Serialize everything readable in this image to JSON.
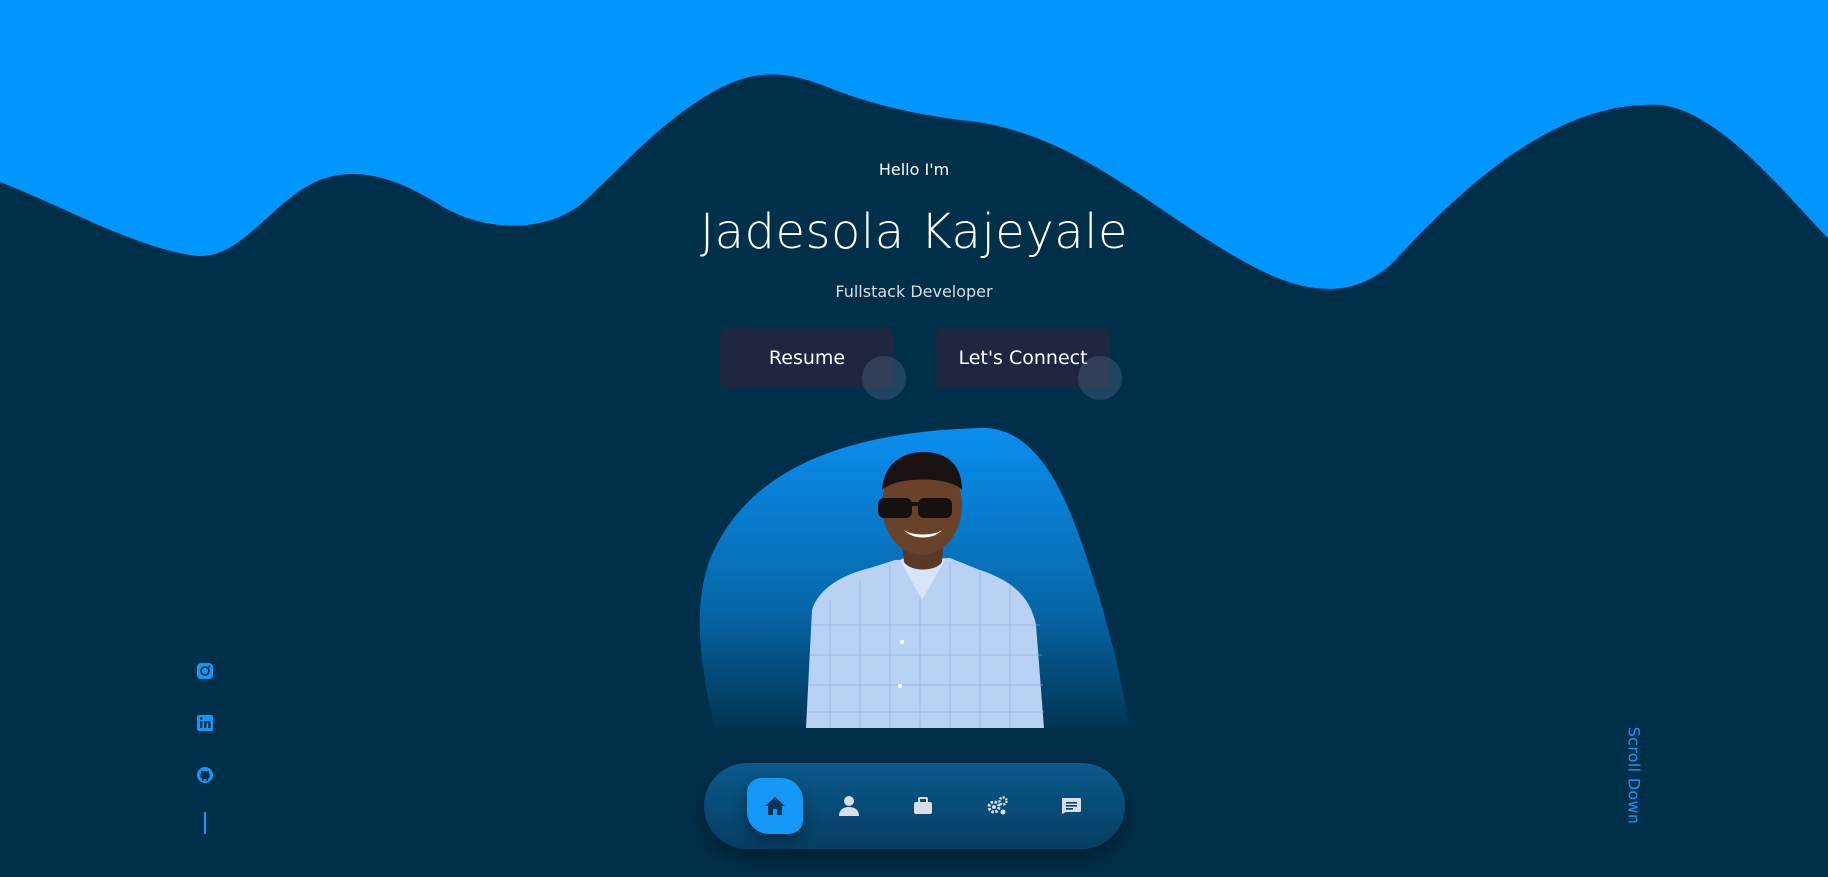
{
  "hero": {
    "greeting": "Hello I'm",
    "name": "Jadesola Kajeyale",
    "role": "Fullstack Developer"
  },
  "buttons": {
    "resume_label": "Resume",
    "connect_label": "Let's Connect"
  },
  "nav": {
    "items": [
      {
        "icon": "home-icon",
        "active": true
      },
      {
        "icon": "user-icon",
        "active": false
      },
      {
        "icon": "briefcase-icon",
        "active": false
      },
      {
        "icon": "gears-icon",
        "active": false
      },
      {
        "icon": "message-icon",
        "active": false
      }
    ]
  },
  "socials": {
    "items": [
      "instagram-icon",
      "linkedin-icon",
      "github-icon"
    ]
  },
  "scroll": {
    "label": "Scroll Down"
  },
  "colors": {
    "background": "#002f4a",
    "wave": "#0096ff",
    "accent": "#1597f5",
    "button": "#1f2740"
  }
}
